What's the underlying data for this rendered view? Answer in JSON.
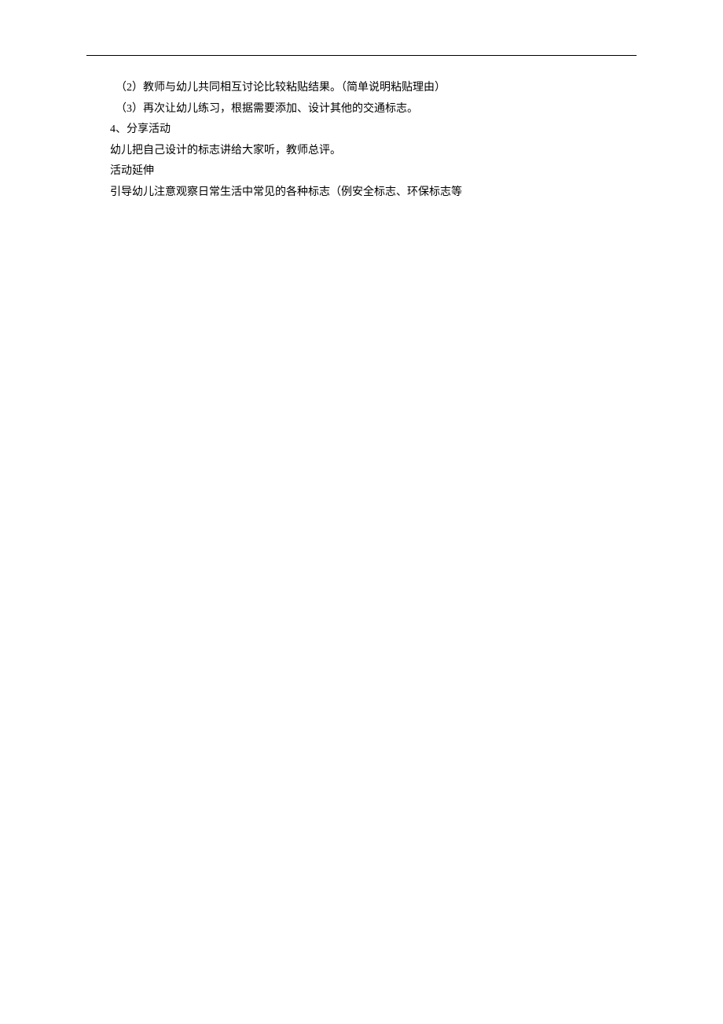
{
  "lines": [
    "　（2）教师与幼儿共同相互讨论比较粘贴结果。（简单说明粘贴理由）",
    "　（3）再次让幼儿练习，根据需要添加、设计其他的交通标志。",
    "4、分享活动",
    "幼儿把自己设计的标志讲给大家听，教师总评。",
    "活动延伸",
    "引导幼儿注意观察日常生活中常见的各种标志（例安全标志、环保标志等"
  ]
}
